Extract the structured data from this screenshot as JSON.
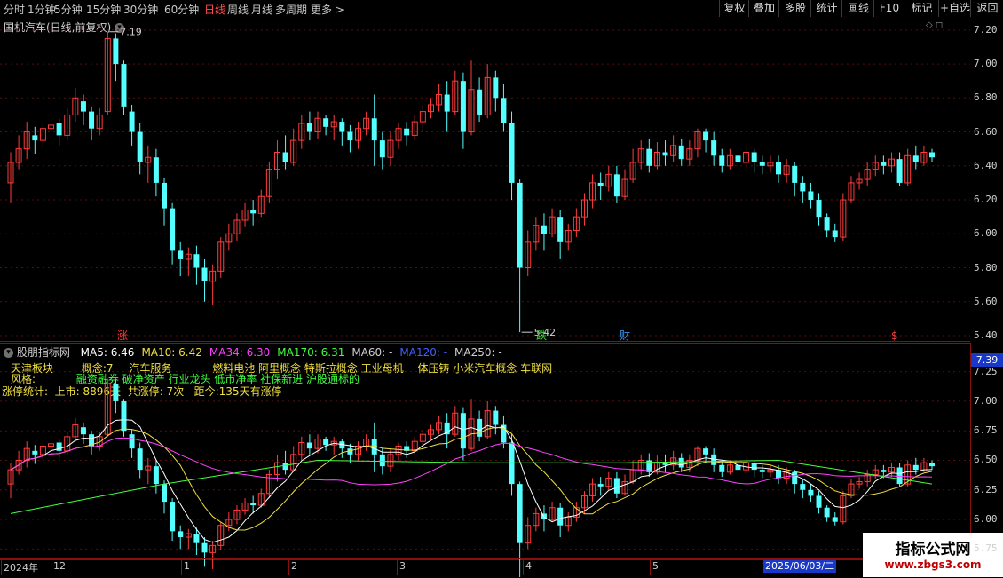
{
  "toolbar": {
    "timeframes": [
      "分时",
      "1分钟",
      "5分钟",
      "15分钟",
      "30分钟",
      "60分钟",
      "日线",
      "周线",
      "月线",
      "多周期",
      "更多"
    ],
    "more_arrow": ">",
    "actions": [
      "复权",
      "叠加",
      "多股",
      "统计",
      "画线",
      "F10",
      "标记",
      "+自选",
      "返回"
    ]
  },
  "main_panel": {
    "title": "国机汽车(日线,前复权)",
    "high_marker": "7.19",
    "low_marker": "5.42",
    "y_ticks": [
      "7.20",
      "7.00",
      "6.80",
      "6.60",
      "6.40",
      "6.20",
      "6.00",
      "5.80",
      "5.60",
      "5.40"
    ],
    "event_marks": [
      {
        "label": "涨",
        "color": "#ff3c3c"
      },
      {
        "label": "跌",
        "color": "#40d040"
      },
      {
        "label": "财",
        "color": "#40a0ff"
      },
      {
        "label": "$",
        "color": "#ff3c3c"
      }
    ]
  },
  "sub_panel": {
    "title": "股朋指标网",
    "ma": [
      {
        "label": "MA5: 6.46",
        "color": "#ffffff"
      },
      {
        "label": "MA10: 6.42",
        "color": "#f0e040"
      },
      {
        "label": "MA34: 6.30",
        "color": "#ff40ff"
      },
      {
        "label": "MA170: 6.31",
        "color": "#40ff40"
      },
      {
        "label": "MA60: -",
        "color": "#d0d0d0"
      },
      {
        "label": "MA120: -",
        "color": "#4060ff"
      },
      {
        "label": "MA250: -",
        "color": "#d0d0d0"
      }
    ],
    "info_line1": {
      "sector": "天津板块",
      "concept_count": "概念:7",
      "industry": "汽车服务",
      "concepts": "燃料电池 阿里概念 特斯拉概念 工业母机 一体压铸 小米汽车概念 车联网"
    },
    "info_line2": {
      "style_label": "风格:",
      "styles": "融资融券 破净资产 行业龙头 低市净率 社保新进 沪股通标的"
    },
    "info_line3": "涨停统计:  上市: 8896天  共涨停: 7次   距今:135天有涨停",
    "price_tag": "7.39",
    "y_ticks": [
      "7.25",
      "7.00",
      "6.75",
      "6.50",
      "6.25",
      "6.00",
      "5.75"
    ]
  },
  "x_axis": {
    "labels": [
      "2024年",
      "12",
      "1",
      "2",
      "3",
      "4",
      "5"
    ],
    "cursor_date": "2025/06/03/二"
  },
  "watermark": {
    "title": "指标公式网",
    "url": "www.zbgs3.com"
  },
  "colors": {
    "up": "#ff3c3c",
    "down": "#54ffff",
    "ma5": "#ffffff",
    "ma10": "#f0e040",
    "ma34": "#ff40ff",
    "ma170": "#40ff40",
    "grid": "#8a1010"
  },
  "chart_data": {
    "type": "candlestick",
    "ylim": [
      5.4,
      7.22
    ],
    "candles": [
      [
        6.3,
        6.42,
        6.18,
        6.48
      ],
      [
        6.42,
        6.5,
        6.38,
        6.58
      ],
      [
        6.5,
        6.6,
        6.44,
        6.66
      ],
      [
        6.58,
        6.55,
        6.47,
        6.63
      ],
      [
        6.55,
        6.62,
        6.5,
        6.65
      ],
      [
        6.62,
        6.64,
        6.55,
        6.7
      ],
      [
        6.65,
        6.58,
        6.52,
        6.68
      ],
      [
        6.58,
        6.7,
        6.55,
        6.74
      ],
      [
        6.7,
        6.8,
        6.66,
        6.86
      ],
      [
        6.78,
        6.72,
        6.64,
        6.82
      ],
      [
        6.72,
        6.62,
        6.55,
        6.75
      ],
      [
        6.62,
        6.7,
        6.58,
        6.74
      ],
      [
        6.72,
        7.15,
        6.7,
        7.19
      ],
      [
        7.15,
        7.0,
        6.9,
        7.18
      ],
      [
        7.0,
        6.75,
        6.7,
        7.02
      ],
      [
        6.72,
        6.6,
        6.52,
        6.76
      ],
      [
        6.6,
        6.42,
        6.35,
        6.65
      ],
      [
        6.42,
        6.45,
        6.3,
        6.52
      ],
      [
        6.45,
        6.3,
        6.22,
        6.5
      ],
      [
        6.3,
        6.15,
        6.05,
        6.33
      ],
      [
        6.15,
        5.9,
        5.82,
        6.18
      ],
      [
        5.9,
        5.85,
        5.75,
        5.95
      ],
      [
        5.85,
        5.88,
        5.75,
        5.92
      ],
      [
        5.88,
        5.8,
        5.7,
        5.93
      ],
      [
        5.8,
        5.72,
        5.6,
        5.85
      ],
      [
        5.72,
        5.78,
        5.58,
        5.82
      ],
      [
        5.78,
        5.95,
        5.74,
        5.98
      ],
      [
        5.95,
        6.0,
        5.9,
        6.06
      ],
      [
        6.0,
        6.08,
        5.96,
        6.12
      ],
      [
        6.08,
        6.14,
        6.04,
        6.18
      ],
      [
        6.14,
        6.12,
        6.05,
        6.2
      ],
      [
        6.12,
        6.22,
        6.1,
        6.26
      ],
      [
        6.22,
        6.38,
        6.18,
        6.42
      ],
      [
        6.38,
        6.48,
        6.32,
        6.55
      ],
      [
        6.48,
        6.42,
        6.38,
        6.58
      ],
      [
        6.42,
        6.55,
        6.4,
        6.62
      ],
      [
        6.55,
        6.65,
        6.5,
        6.7
      ],
      [
        6.65,
        6.6,
        6.55,
        6.72
      ],
      [
        6.6,
        6.68,
        6.56,
        6.72
      ],
      [
        6.68,
        6.63,
        6.58,
        6.7
      ],
      [
        6.63,
        6.66,
        6.55,
        6.7
      ],
      [
        6.66,
        6.6,
        6.52,
        6.68
      ],
      [
        6.6,
        6.55,
        6.48,
        6.64
      ],
      [
        6.55,
        6.62,
        6.5,
        6.66
      ],
      [
        6.62,
        6.68,
        6.58,
        6.72
      ],
      [
        6.68,
        6.55,
        6.4,
        6.82
      ],
      [
        6.55,
        6.45,
        6.38,
        6.6
      ],
      [
        6.45,
        6.55,
        6.4,
        6.6
      ],
      [
        6.55,
        6.62,
        6.5,
        6.65
      ],
      [
        6.62,
        6.58,
        6.52,
        6.66
      ],
      [
        6.58,
        6.66,
        6.55,
        6.7
      ],
      [
        6.66,
        6.72,
        6.6,
        6.76
      ],
      [
        6.72,
        6.76,
        6.68,
        6.8
      ],
      [
        6.76,
        6.82,
        6.72,
        6.88
      ],
      [
        6.82,
        6.72,
        6.6,
        6.9
      ],
      [
        6.72,
        6.9,
        6.7,
        6.96
      ],
      [
        6.9,
        6.6,
        6.5,
        6.95
      ],
      [
        6.6,
        6.85,
        6.58,
        7.02
      ],
      [
        6.85,
        6.7,
        6.66,
        6.92
      ],
      [
        6.7,
        6.92,
        6.68,
        7.0
      ],
      [
        6.92,
        6.8,
        6.72,
        6.96
      ],
      [
        6.8,
        6.65,
        6.6,
        6.88
      ],
      [
        6.65,
        6.3,
        6.2,
        6.72
      ],
      [
        6.3,
        5.8,
        5.42,
        6.32
      ],
      [
        5.8,
        5.95,
        5.75,
        6.02
      ],
      [
        5.95,
        6.05,
        5.9,
        6.1
      ],
      [
        6.05,
        6.0,
        5.9,
        6.12
      ],
      [
        6.0,
        6.1,
        5.98,
        6.15
      ],
      [
        6.1,
        5.95,
        5.85,
        6.14
      ],
      [
        5.95,
        6.02,
        5.9,
        6.06
      ],
      [
        6.02,
        6.1,
        5.98,
        6.15
      ],
      [
        6.1,
        6.2,
        6.05,
        6.24
      ],
      [
        6.2,
        6.3,
        6.15,
        6.35
      ],
      [
        6.3,
        6.28,
        6.2,
        6.36
      ],
      [
        6.28,
        6.35,
        6.25,
        6.4
      ],
      [
        6.35,
        6.22,
        6.18,
        6.4
      ],
      [
        6.22,
        6.32,
        6.2,
        6.38
      ],
      [
        6.32,
        6.42,
        6.3,
        6.5
      ],
      [
        6.42,
        6.5,
        6.38,
        6.55
      ],
      [
        6.5,
        6.4,
        6.36,
        6.56
      ],
      [
        6.4,
        6.48,
        6.38,
        6.54
      ],
      [
        6.48,
        6.46,
        6.4,
        6.55
      ],
      [
        6.46,
        6.52,
        6.42,
        6.58
      ],
      [
        6.52,
        6.44,
        6.4,
        6.56
      ],
      [
        6.44,
        6.5,
        6.4,
        6.55
      ],
      [
        6.5,
        6.6,
        6.45,
        6.62
      ],
      [
        6.6,
        6.55,
        6.48,
        6.62
      ],
      [
        6.55,
        6.46,
        6.4,
        6.6
      ],
      [
        6.46,
        6.4,
        6.36,
        6.5
      ],
      [
        6.4,
        6.46,
        6.38,
        6.5
      ],
      [
        6.46,
        6.42,
        6.38,
        6.5
      ],
      [
        6.42,
        6.48,
        6.38,
        6.52
      ],
      [
        6.48,
        6.42,
        6.36,
        6.5
      ],
      [
        6.42,
        6.4,
        6.35,
        6.46
      ],
      [
        6.4,
        6.42,
        6.36,
        6.46
      ],
      [
        6.42,
        6.35,
        6.3,
        6.46
      ],
      [
        6.35,
        6.4,
        6.3,
        6.44
      ],
      [
        6.4,
        6.3,
        6.22,
        6.42
      ],
      [
        6.3,
        6.25,
        6.18,
        6.34
      ],
      [
        6.25,
        6.2,
        6.15,
        6.3
      ],
      [
        6.2,
        6.1,
        6.05,
        6.24
      ],
      [
        6.1,
        6.02,
        5.98,
        6.12
      ],
      [
        6.02,
        5.98,
        5.95,
        6.06
      ],
      [
        5.98,
        6.2,
        5.96,
        6.24
      ],
      [
        6.2,
        6.3,
        6.18,
        6.34
      ],
      [
        6.3,
        6.32,
        6.26,
        6.36
      ],
      [
        6.32,
        6.38,
        6.28,
        6.42
      ],
      [
        6.38,
        6.42,
        6.34,
        6.46
      ],
      [
        6.42,
        6.4,
        6.35,
        6.46
      ],
      [
        6.4,
        6.44,
        6.36,
        6.48
      ],
      [
        6.44,
        6.3,
        6.28,
        6.48
      ],
      [
        6.3,
        6.46,
        6.28,
        6.5
      ],
      [
        6.46,
        6.42,
        6.38,
        6.52
      ],
      [
        6.42,
        6.48,
        6.4,
        6.52
      ],
      [
        6.48,
        6.45,
        6.42,
        6.5
      ]
    ]
  }
}
